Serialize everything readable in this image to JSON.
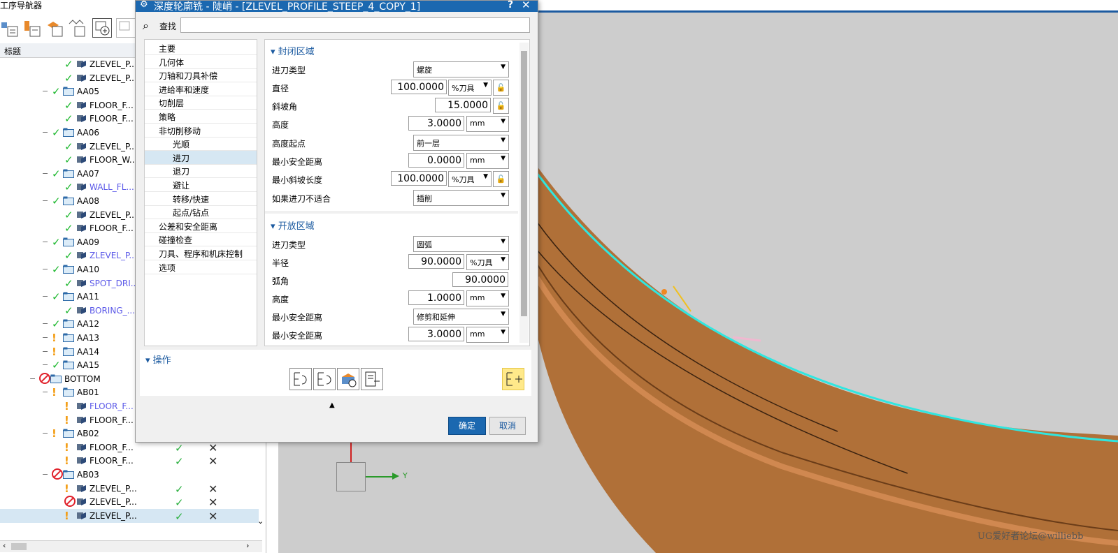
{
  "navigator": {
    "title": "工序导航器",
    "column_title": "标题",
    "rows": [
      {
        "label": "ZLEVEL_P...",
        "status": "check",
        "type": "op",
        "indent": 3,
        "link": false
      },
      {
        "label": "ZLEVEL_P...",
        "status": "check",
        "type": "op",
        "indent": 3,
        "link": false
      },
      {
        "label": "AA05",
        "status": "check",
        "type": "group",
        "indent": 2,
        "link": false
      },
      {
        "label": "FLOOR_F...",
        "status": "check",
        "type": "op",
        "indent": 3,
        "link": false
      },
      {
        "label": "FLOOR_F...",
        "status": "check",
        "type": "op",
        "indent": 3,
        "link": false
      },
      {
        "label": "AA06",
        "status": "check",
        "type": "group",
        "indent": 2,
        "link": false
      },
      {
        "label": "ZLEVEL_P...",
        "status": "check",
        "type": "op",
        "indent": 3,
        "link": false
      },
      {
        "label": "FLOOR_W...",
        "status": "check",
        "type": "op",
        "indent": 3,
        "link": false
      },
      {
        "label": "AA07",
        "status": "check",
        "type": "group",
        "indent": 2,
        "link": false
      },
      {
        "label": "WALL_FL...",
        "status": "check",
        "type": "op",
        "indent": 3,
        "link": true
      },
      {
        "label": "AA08",
        "status": "check",
        "type": "group",
        "indent": 2,
        "link": false
      },
      {
        "label": "ZLEVEL_P...",
        "status": "check",
        "type": "op",
        "indent": 3,
        "link": false
      },
      {
        "label": "FLOOR_F...",
        "status": "check",
        "type": "op",
        "indent": 3,
        "link": false
      },
      {
        "label": "AA09",
        "status": "check",
        "type": "group",
        "indent": 2,
        "link": false
      },
      {
        "label": "ZLEVEL_P...",
        "status": "check",
        "type": "op",
        "indent": 3,
        "link": true
      },
      {
        "label": "AA10",
        "status": "check",
        "type": "group",
        "indent": 2,
        "link": false
      },
      {
        "label": "SPOT_DRI...",
        "status": "check",
        "type": "op",
        "indent": 3,
        "link": true
      },
      {
        "label": "AA11",
        "status": "check",
        "type": "group",
        "indent": 2,
        "link": false
      },
      {
        "label": "BORING_...",
        "status": "check",
        "type": "op",
        "indent": 3,
        "link": true
      },
      {
        "label": "AA12",
        "status": "check",
        "type": "group",
        "indent": 2,
        "link": false
      },
      {
        "label": "AA13",
        "status": "warn",
        "type": "group",
        "indent": 2,
        "link": false
      },
      {
        "label": "AA14",
        "status": "warn",
        "type": "group",
        "indent": 2,
        "link": false
      },
      {
        "label": "AA15",
        "status": "check",
        "type": "group",
        "indent": 2,
        "link": false
      },
      {
        "label": "BOTTOM",
        "status": "forbid",
        "type": "group",
        "indent": 1,
        "link": false
      },
      {
        "label": "AB01",
        "status": "warn",
        "type": "group",
        "indent": 2,
        "link": false
      },
      {
        "label": "FLOOR_F...",
        "status": "warn",
        "type": "op",
        "indent": 3,
        "link": true
      },
      {
        "label": "FLOOR_F...",
        "status": "warn",
        "type": "op",
        "indent": 3,
        "link": false
      },
      {
        "label": "AB02",
        "status": "warn",
        "type": "group",
        "indent": 2,
        "link": false
      },
      {
        "label": "FLOOR_F...",
        "status": "warn",
        "type": "op",
        "indent": 3,
        "link": false,
        "cols": true
      },
      {
        "label": "FLOOR_F...",
        "status": "warn",
        "type": "op",
        "indent": 3,
        "link": false,
        "cols": true
      },
      {
        "label": "AB03",
        "status": "forbid",
        "type": "group",
        "indent": 2,
        "link": false
      },
      {
        "label": "ZLEVEL_P...",
        "status": "warn",
        "type": "op",
        "indent": 3,
        "link": false,
        "cols": true
      },
      {
        "label": "ZLEVEL_P...",
        "status": "forbid",
        "type": "op",
        "indent": 3,
        "link": false,
        "cols": true
      },
      {
        "label": "ZLEVEL_P...",
        "status": "warn",
        "type": "op",
        "indent": 3,
        "link": false,
        "cols": true,
        "selected": true
      }
    ]
  },
  "dialog": {
    "title": "深度轮廓铣 - 陡峭 - [ZLEVEL_PROFILE_STEEP_4_COPY_1]",
    "help": "?",
    "close": "✕",
    "find_label": "查找",
    "tree": [
      {
        "label": "主要",
        "indent": 0
      },
      {
        "label": "几何体",
        "indent": 0
      },
      {
        "label": "刀轴和刀具补偿",
        "indent": 0
      },
      {
        "label": "进给率和速度",
        "indent": 0
      },
      {
        "label": "切削层",
        "indent": 0
      },
      {
        "label": "策略",
        "indent": 0
      },
      {
        "label": "非切削移动",
        "indent": 0
      },
      {
        "label": "光顺",
        "indent": 1
      },
      {
        "label": "进刀",
        "indent": 1,
        "selected": true
      },
      {
        "label": "退刀",
        "indent": 1
      },
      {
        "label": "避让",
        "indent": 1
      },
      {
        "label": "转移/快速",
        "indent": 1
      },
      {
        "label": "起点/钻点",
        "indent": 1
      },
      {
        "label": "公差和安全距离",
        "indent": 0
      },
      {
        "label": "碰撞检查",
        "indent": 0
      },
      {
        "label": "刀具、程序和机床控制",
        "indent": 0
      },
      {
        "label": "选项",
        "indent": 0
      }
    ],
    "closed_area": {
      "header": "封闭区域",
      "engage_type_label": "进刀类型",
      "engage_type_value": "螺旋",
      "diameter_label": "直径",
      "diameter_value": "100.0000",
      "diameter_unit": "%刀具",
      "ramp_angle_label": "斜坡角",
      "ramp_angle_value": "15.0000",
      "height_label": "高度",
      "height_value": "3.0000",
      "height_unit": "mm",
      "height_from_label": "高度起点",
      "height_from_value": "前一层",
      "min_clearance_label": "最小安全距离",
      "min_clearance_value": "0.0000",
      "min_clearance_unit": "mm",
      "min_ramp_label": "最小斜坡长度",
      "min_ramp_value": "100.0000",
      "min_ramp_unit": "%刀具",
      "if_not_fit_label": "如果进刀不适合",
      "if_not_fit_value": "插削"
    },
    "open_area": {
      "header": "开放区域",
      "engage_type_label": "进刀类型",
      "engage_type_value": "圆弧",
      "radius_label": "半径",
      "radius_value": "90.0000",
      "radius_unit": "%刀具",
      "arc_angle_label": "弧角",
      "arc_angle_value": "90.0000",
      "height_label": "高度",
      "height_value": "1.0000",
      "height_unit": "mm",
      "min_clearance_label": "最小安全距离",
      "min_clearance_value": "修剪和延伸",
      "min_clearance2_label": "最小安全距离",
      "min_clearance2_value": "3.0000",
      "min_clearance2_unit": "mm"
    },
    "actions": {
      "header": "操作"
    },
    "ok_label": "确定",
    "cancel_label": "取消"
  },
  "viewport": {
    "axis_label": "Y",
    "watermark": "UG爱好者论坛@williebb"
  }
}
